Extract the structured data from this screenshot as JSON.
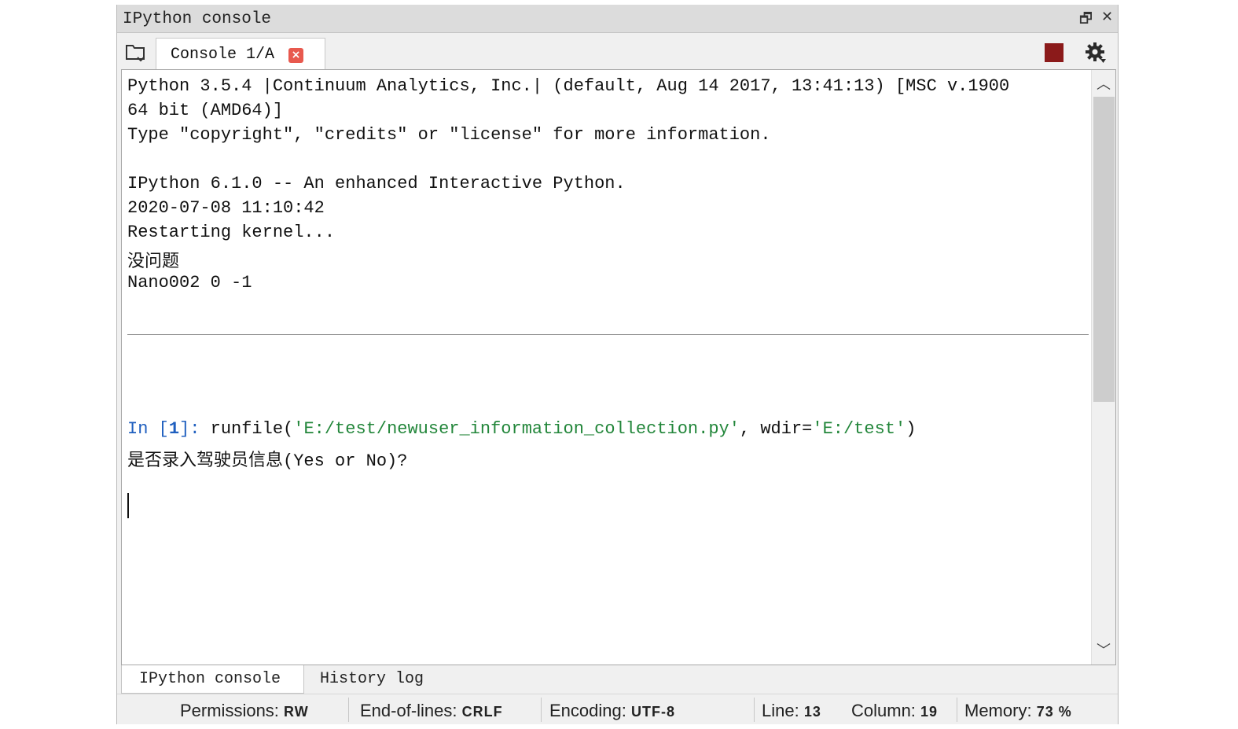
{
  "window": {
    "title": "IPython console",
    "restore_glyph": "🗗",
    "close_glyph": "✕"
  },
  "toolbar": {
    "tab_label": "Console 1/A",
    "tab_close_glyph": "×",
    "browse_icon": "folder-browse-icon",
    "stop_icon": "stop-square-icon",
    "options_icon": "gear-icon",
    "stop_color": "#8b1a1a"
  },
  "console": {
    "banner": [
      "Python 3.5.4 |Continuum Analytics, Inc.| (default, Aug 14 2017, 13:41:13) [MSC v.1900",
      "64 bit (AMD64)]",
      "Type \"copyright\", \"credits\" or \"license\" for more information.",
      "",
      "IPython 6.1.0 -- An enhanced Interactive Python.",
      "2020-07-08 11:10:42",
      "Restarting kernel...",
      "没问题",
      "Nano002 0 -1"
    ],
    "prompt_in": "In [",
    "prompt_num": "1",
    "prompt_close": "]: ",
    "cmd_func": "runfile(",
    "cmd_arg1": "'E:/test/newuser_information_collection.py'",
    "cmd_mid": ", wdir=",
    "cmd_arg2": "'E:/test'",
    "cmd_end": ")",
    "output": "是否录入驾驶员信息(Yes or No)?",
    "prompt_color": "#1f5fbf",
    "string_color": "#22863a"
  },
  "scrollbar": {
    "up_glyph": "︿",
    "down_glyph": "﹀"
  },
  "bottom_tabs": {
    "ipython": "IPython console",
    "history": "History log"
  },
  "status": {
    "permissions_label": "Permissions:",
    "permissions_value": "RW",
    "eol_label": "End-of-lines:",
    "eol_value": "CRLF",
    "encoding_label": "Encoding:",
    "encoding_value": "UTF-8",
    "line_label": "Line:",
    "line_value": "13",
    "column_label": "Column:",
    "column_value": "19",
    "memory_label": "Memory:",
    "memory_value": "73 %"
  }
}
